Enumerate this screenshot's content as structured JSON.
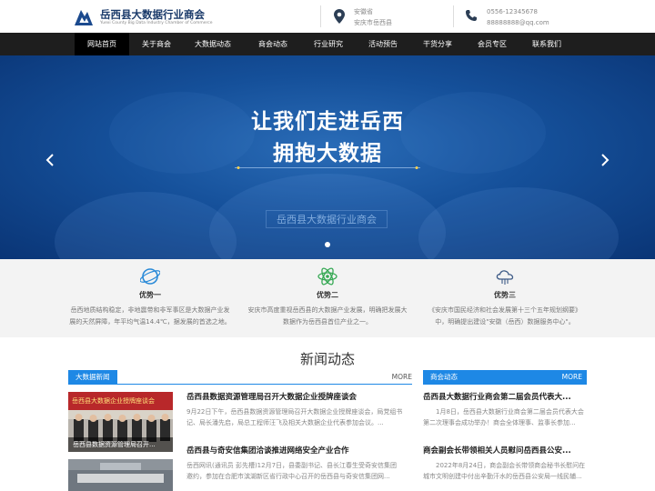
{
  "header": {
    "logo_title": "岳西县大数据行业商会",
    "logo_subtitle": "Yuexi County Big Data Industry Chamber of Commerce",
    "location_line1": "安徽省",
    "location_line2": "安庆市岳西县",
    "phone": "0556-12345678",
    "email": "88888888@qq.com"
  },
  "nav": {
    "items": [
      {
        "label": "网站首页"
      },
      {
        "label": "关于商会"
      },
      {
        "label": "大数据动态"
      },
      {
        "label": "商会动态"
      },
      {
        "label": "行业研究"
      },
      {
        "label": "活动预告"
      },
      {
        "label": "干货分享"
      },
      {
        "label": "会员专区"
      },
      {
        "label": "联系我们"
      }
    ]
  },
  "banner": {
    "line1": "让我们走进岳西",
    "line2": "拥抱大数据",
    "subtitle": "岳西县大数据行业商会"
  },
  "advantages": [
    {
      "title": "优势一",
      "desc1": "岳西地质结构稳定，非地震带和非军事区是大数据产业发",
      "desc2": "展的天然屏障，年平均气温14.4℃，据发展的首选之地。"
    },
    {
      "title": "优势二",
      "desc1": "安庆市高度重视岳西县的大数据产业发展，明确把发展大",
      "desc2": "数据作为岳西县首位产业之一。"
    },
    {
      "title": "优势三",
      "desc1": "《安庆市国民经济和社会发展第十三个五年规划纲要》",
      "desc2": "中，明确提出建设\"安徽（岳西）数据服务中心\"。"
    }
  ],
  "news_section": {
    "title": "新闻动态",
    "left_tab": "大数据新闻",
    "left_more": "MORE",
    "right_tab": "商会动态",
    "right_more": "MORE",
    "left_items": [
      {
        "caption": "岳西县数据资源管理局召开...",
        "title": "岳西县数据资源管理局召开大数据企业授牌座谈会",
        "body1": "9月22日下午，岳西县数据资源管理局召开大数据企业授牌座谈会，局党组书",
        "body2": "记、局长潘先启，局总工程师汪飞及相关大数据企业代表参加会议。..."
      },
      {
        "caption": "",
        "title": "岳西县与奇安信集团洽谈推进网络安全产业合作",
        "body1": "岳西网讯(通讯员 彭先槽)12月7日，县委副书记、县长江春生受奇安信集团",
        "body2": "邀约，参加在合肥市滨湖新区省行政中心召开的岳西县与奇安信集团网..."
      }
    ],
    "right_items": [
      {
        "title": "岳西县大数据行业商会第二届会员代表大...",
        "body1": "1月8日，岳西县大数据行业商会第二届会员代表大会",
        "body2": "第二次理事会成功举办！商会全体理事、监事长参加..."
      },
      {
        "title": "商会副会长带领相关人员慰问岳西县公安...",
        "body1": "2022年8月24日，商会副会长带领商会秘书长慰问在",
        "body2": "城市文明创建中付出辛勤汗水的岳西县公安局一线民辅..."
      }
    ],
    "thumb1_banner_text": "岳西县大数据企业授牌座谈会"
  },
  "colors": {
    "accent": "#1e88e5",
    "nav_bg": "#1e1e1e",
    "banner": "#15509a"
  }
}
